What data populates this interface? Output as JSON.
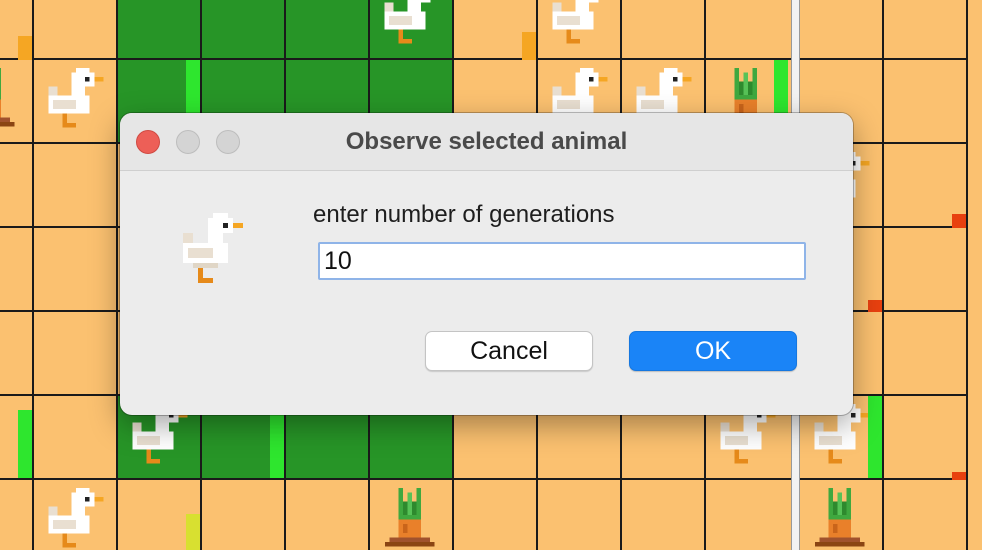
{
  "board": {
    "grass_cells": [
      [
        2,
        0
      ],
      [
        3,
        0
      ],
      [
        4,
        0
      ],
      [
        5,
        0
      ],
      [
        2,
        1
      ],
      [
        3,
        1
      ],
      [
        4,
        1
      ],
      [
        5,
        1
      ],
      [
        2,
        5
      ],
      [
        3,
        5
      ],
      [
        4,
        5
      ],
      [
        5,
        5
      ]
    ],
    "sprites": [
      {
        "kind": "chicken",
        "col": 5,
        "row": 0
      },
      {
        "kind": "chicken",
        "col": 7,
        "row": 0
      },
      {
        "kind": "chicken",
        "col": 1,
        "row": 1
      },
      {
        "kind": "carrot",
        "col": 0,
        "row": 1
      },
      {
        "kind": "carrot",
        "col": 9,
        "row": 1
      },
      {
        "kind": "chicken",
        "col": 7,
        "row": 1
      },
      {
        "kind": "chicken",
        "col": 8,
        "row": 1
      },
      {
        "kind": "chicken",
        "col": 10,
        "row": 2
      },
      {
        "kind": "chicken",
        "col": 2,
        "row": 5
      },
      {
        "kind": "chicken",
        "col": 9,
        "row": 5
      },
      {
        "kind": "chicken",
        "col": 10,
        "row": 5
      },
      {
        "kind": "chicken",
        "col": 1,
        "row": 6
      },
      {
        "kind": "carrot",
        "col": 5,
        "row": 6
      },
      {
        "kind": "carrot",
        "col": 10,
        "row": 6
      }
    ],
    "colors": {
      "sand": "#fbc170",
      "grass": "#279527",
      "grid": "#1a1a1a",
      "energy_green": "#2ee62e",
      "energy_orange": "#f5a623",
      "energy_red": "#e8400f"
    }
  },
  "dialog": {
    "title": "Observe selected animal",
    "prompt": "enter number of generations",
    "input_value": "10",
    "cancel_label": "Cancel",
    "ok_label": "OK",
    "icon": "chicken-icon"
  }
}
